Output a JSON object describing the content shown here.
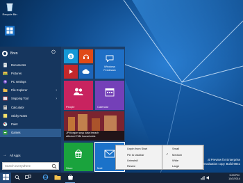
{
  "desktop": {
    "icons": [
      {
        "label": "Recycle Bin",
        "icon": "recycle-bin-icon"
      },
      {
        "label": "",
        "icon": "computer-icon"
      }
    ],
    "watermark": {
      "line1": "al Preview for Enterprise",
      "line2": "Evaluation copy. Build 9841"
    }
  },
  "start_menu": {
    "user_name": "Bren",
    "power_icon": "power-icon",
    "items": [
      {
        "label": "Documents",
        "icon": "documents-icon"
      },
      {
        "label": "Pictures",
        "icon": "pictures-icon"
      },
      {
        "label": "PC settings",
        "icon": "gear-icon"
      },
      {
        "label": "File Explorer",
        "icon": "folder-icon",
        "has_arrow": true
      },
      {
        "label": "Snipping Tool",
        "icon": "scissors-icon",
        "has_arrow": true
      },
      {
        "label": "Calculator",
        "icon": "calculator-icon"
      },
      {
        "label": "Sticky Notes",
        "icon": "sticky-notes-icon"
      },
      {
        "label": "Paint",
        "icon": "paint-icon"
      },
      {
        "label": "Games",
        "icon": "games-icon",
        "selected": true
      }
    ],
    "all_apps_label": "All Apps",
    "search_placeholder": "Search everywhere",
    "tiles": {
      "skype": {
        "icon": "skype-icon",
        "color": "#1598d6"
      },
      "music": {
        "icon": "headphones-icon",
        "color": "#e04a17"
      },
      "windows_feedback": {
        "label1": "Windows",
        "label2": "Feedback",
        "icon": "feedback-icon",
        "color": "#1f6fc5"
      },
      "video": {
        "icon": "video-icon",
        "color": "#c4282b"
      },
      "onedrive": {
        "icon": "cloud-icon",
        "color": "#1d64b8"
      },
      "people": {
        "label": "People",
        "icon": "people-icon",
        "color": "#c8235f"
      },
      "calendar": {
        "label": "Calendar",
        "icon": "calendar-icon",
        "color": "#7440b8"
      },
      "news": {
        "headline1": "JPMorgan says data breach",
        "headline2": "affected 76M households",
        "color": "#6c1d27"
      },
      "store": {
        "label": "Store",
        "icon": "store-icon",
        "color": "#1aa33d"
      },
      "mail": {
        "label": "Mail",
        "icon": "mail-icon",
        "color": "#1b72c9"
      }
    }
  },
  "context_menu": {
    "items": [
      "Unpin from Start",
      "Pin to taskbar",
      "Uninstall",
      "Resize"
    ],
    "resize_arrow": "›",
    "submenu": [
      "Small",
      "Medium",
      "Wide",
      "Large"
    ],
    "checked": "Medium",
    "check_mark": "✓"
  },
  "taskbar": {
    "time": "5:03 PM",
    "date": "10/2/2014",
    "buttons": [
      "start-icon",
      "search-icon",
      "task-view-icon",
      "internet-explorer-icon",
      "file-explorer-icon",
      "store-icon"
    ]
  }
}
